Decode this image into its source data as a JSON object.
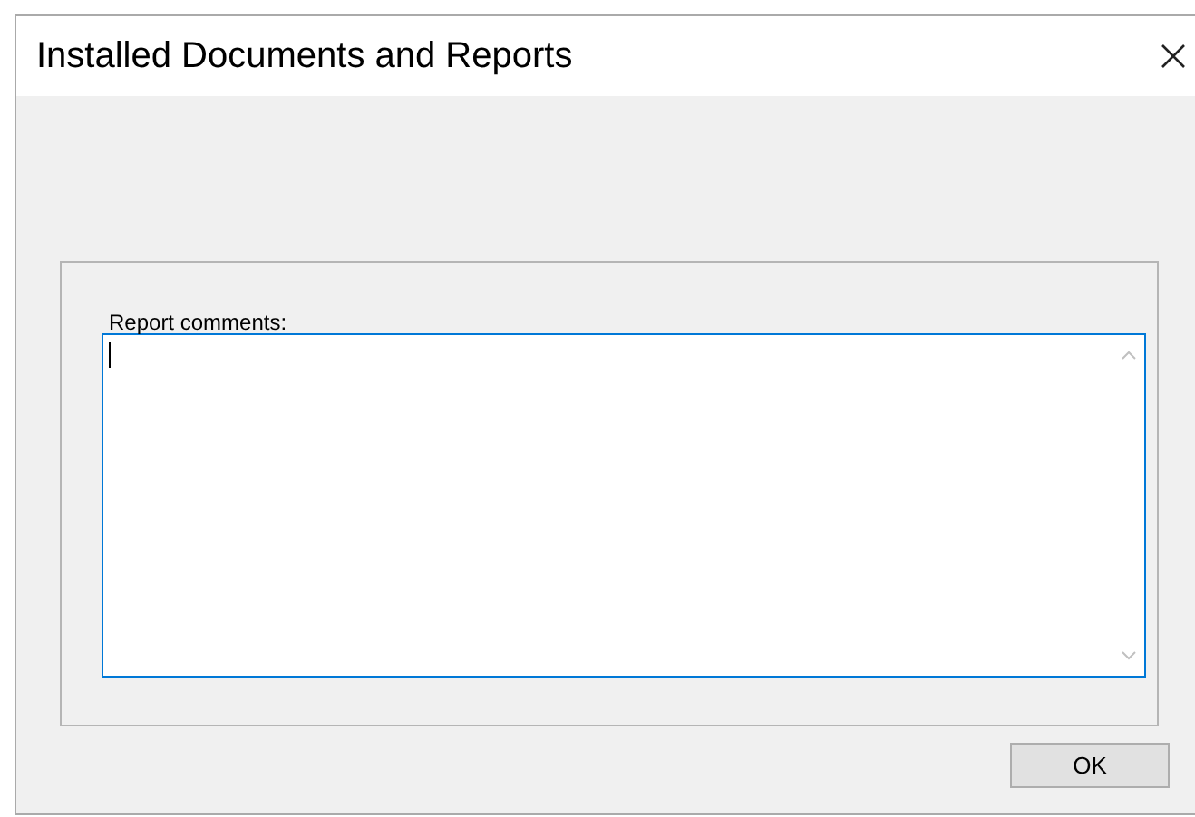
{
  "window": {
    "title": "Installed Documents and Reports"
  },
  "comments": {
    "label": "Report comments:",
    "focused": true
  },
  "buttons": [
    {
      "label": "OK"
    }
  ]
}
